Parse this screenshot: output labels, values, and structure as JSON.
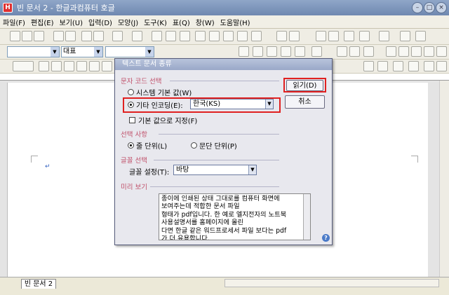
{
  "window": {
    "title": "빈 문서 2 - 한글과컴퓨터 호글",
    "app_icon": "H"
  },
  "menu": [
    "파일(F)",
    "편집(E)",
    "보기(U)",
    "입력(D)",
    "모양(J)",
    "도구(K)",
    "표(Q)",
    "창(W)",
    "도움말(H)"
  ],
  "toolbar": {
    "font_style": "대표"
  },
  "statusbar": {
    "doc_tab": "빈 문서 2"
  },
  "dialog": {
    "title": "텍스트 문서 종류",
    "charset_section": "문자 코드 선택",
    "opt_system": "시스템 기본 값(W)",
    "opt_other": "기타 인코딩(E):",
    "encoding_value": "한국(KS)",
    "check_default": "기본 값으로 지정(F)",
    "select_section": "선택 사항",
    "opt_line": "줄 단위(L)",
    "opt_para": "문단 단위(P)",
    "font_section": "글꼴 선택",
    "font_label": "글꼴 설정(T):",
    "font_value": "바탕",
    "preview_section": "미리 보기",
    "preview_text": "종이에 인쇄된 상태 그대로를 컴퓨터 화면에\n보여주는데 적합한 문서 파일\n형태가 pdf입니다. 한 예로 엘지전자의 노트북\n사용설명서를 홈페이지에 올린\n다면 한글 같은 워드프로세서 파일 보다는 pdf\n가 더 유용합니다.",
    "read_button": "읽기(D)",
    "cancel_button": "취소"
  }
}
